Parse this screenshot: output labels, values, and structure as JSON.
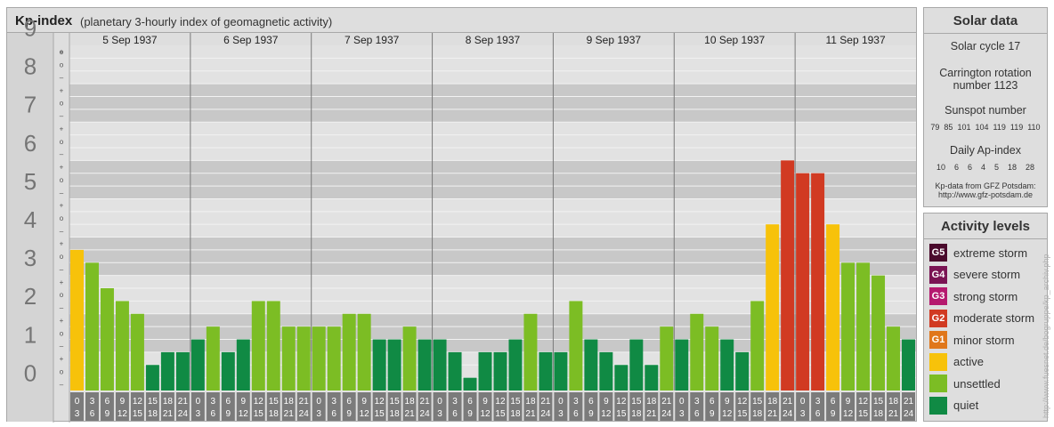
{
  "header": {
    "title": "Kp-index",
    "subtitle": "(planetary 3-hourly index of geomagnetic activity)"
  },
  "solar": {
    "title": "Solar data",
    "cycle": "Solar cycle 17",
    "carrington_line1": "Carrington rotation",
    "carrington_line2": "number 1123",
    "sunspot_title": "Sunspot number",
    "sunspot_values": [
      "79",
      "85",
      "101",
      "104",
      "119",
      "119",
      "110"
    ],
    "ap_title": "Daily Ap-index",
    "ap_values": [
      "10",
      "6",
      "6",
      "4",
      "5",
      "18",
      "28"
    ],
    "source_line1": "Kp-data from GFZ Potsdam:",
    "source_line2": "http://www.gfz-potsdam.de"
  },
  "legend": {
    "title": "Activity levels",
    "items": [
      {
        "code": "G5",
        "label": "extreme storm",
        "color": "#4a0a2c"
      },
      {
        "code": "G4",
        "label": "severe storm",
        "color": "#7a1453"
      },
      {
        "code": "G3",
        "label": "strong storm",
        "color": "#b5196e"
      },
      {
        "code": "G2",
        "label": "moderate storm",
        "color": "#d13a22"
      },
      {
        "code": "G1",
        "label": "minor storm",
        "color": "#e0771b"
      },
      {
        "code": "",
        "label": "active",
        "color": "#f7c20a"
      },
      {
        "code": "",
        "label": "unsettled",
        "color": "#7cbd24"
      },
      {
        "code": "",
        "label": "quiet",
        "color": "#108a44"
      }
    ]
  },
  "watermark": "http://www.fuesnet.de/bogruppe/kp_archiv.php",
  "chart_data": {
    "type": "bar",
    "title": "Kp-index",
    "ylim": [
      0,
      9
    ],
    "y_ticks": [
      "0",
      "1",
      "2",
      "3",
      "4",
      "5",
      "6",
      "7",
      "8",
      "9"
    ],
    "sub_ticks": [
      "+",
      "o",
      "–"
    ],
    "days": [
      "5 Sep 1937",
      "6 Sep 1937",
      "7 Sep 1937",
      "8 Sep 1937",
      "9 Sep 1937",
      "10 Sep 1937",
      "11 Sep 1937"
    ],
    "interval_labels": [
      [
        "0",
        "3"
      ],
      [
        "3",
        "6"
      ],
      [
        "6",
        "9"
      ],
      [
        "9",
        "12"
      ],
      [
        "12",
        "15"
      ],
      [
        "15",
        "18"
      ],
      [
        "18",
        "21"
      ],
      [
        "21",
        "24"
      ]
    ],
    "values": [
      3.667,
      3.333,
      2.667,
      2.333,
      2.0,
      0.667,
      1.0,
      1.0,
      1.333,
      1.667,
      1.0,
      1.333,
      2.333,
      2.333,
      1.667,
      1.667,
      1.667,
      1.667,
      2.0,
      2.0,
      1.333,
      1.333,
      1.667,
      1.333,
      1.333,
      1.0,
      0.333,
      1.0,
      1.0,
      1.333,
      2.0,
      1.0,
      1.0,
      2.333,
      1.333,
      1.0,
      0.667,
      1.333,
      0.667,
      1.667,
      1.333,
      2.0,
      1.667,
      1.333,
      1.0,
      2.333,
      4.333,
      6.0,
      5.667,
      5.667,
      4.333,
      3.333,
      3.333,
      3.0,
      1.667,
      1.333
    ],
    "colors": {
      "quiet": "#108a44",
      "unsettled": "#7cbd24",
      "active": "#f7c20a",
      "storm": "#d13a22"
    }
  }
}
